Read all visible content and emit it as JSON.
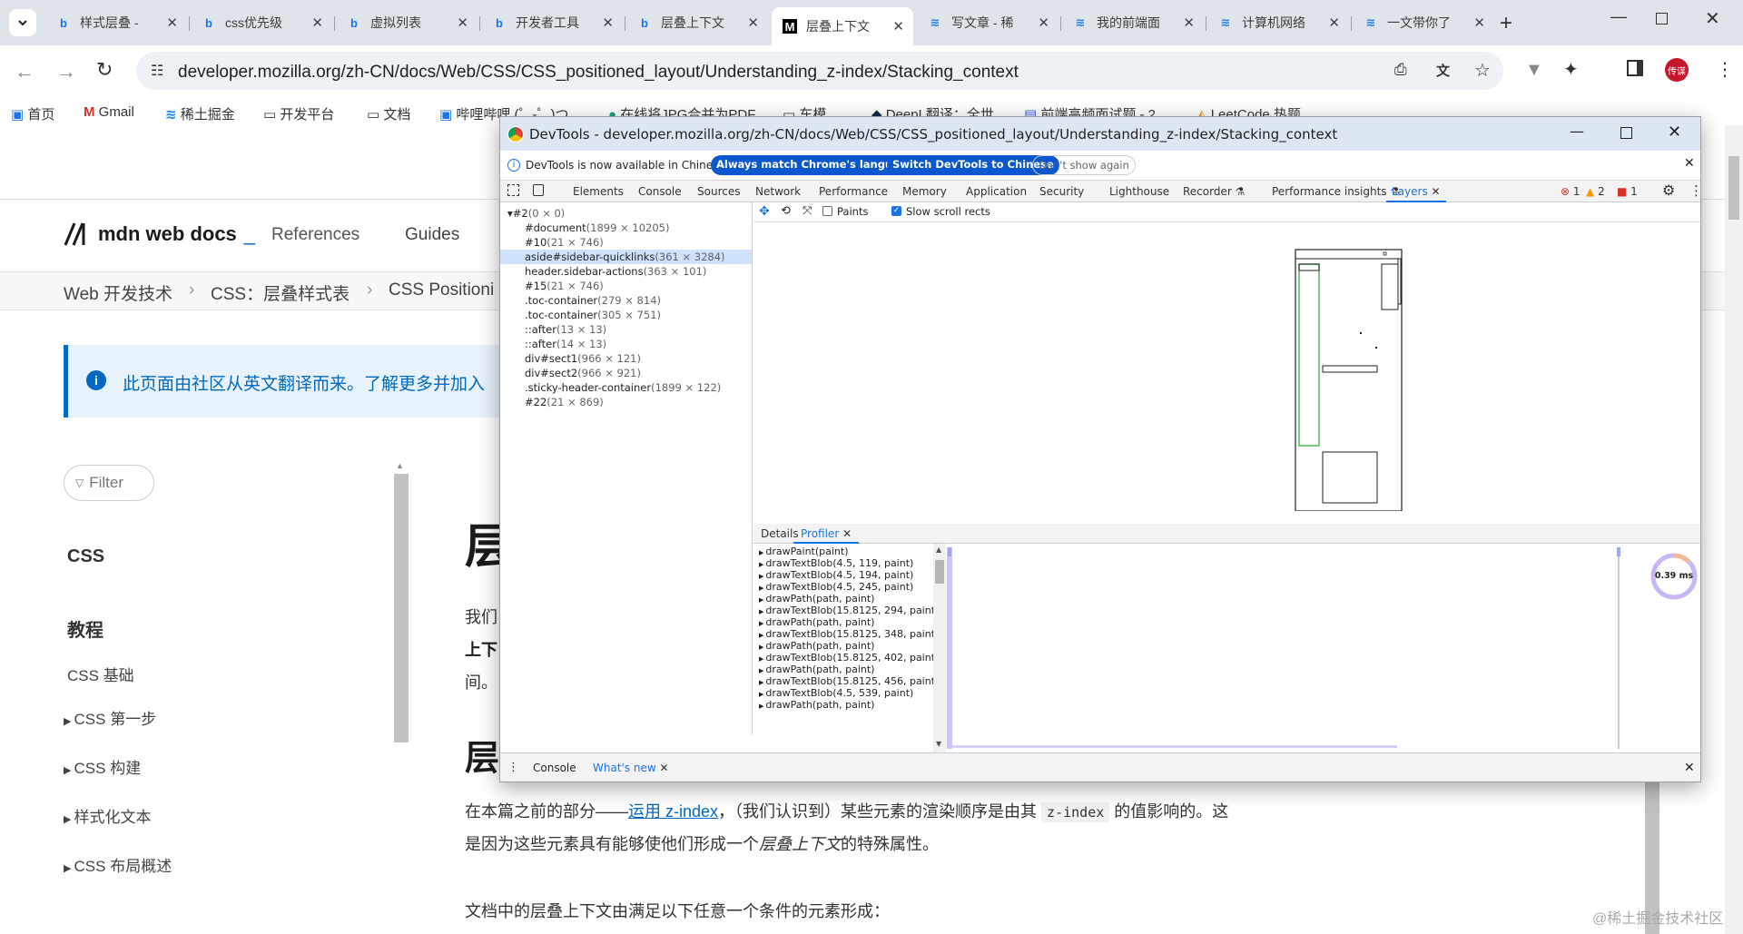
{
  "browser": {
    "tabs": [
      {
        "icon": "bing-icon",
        "title": "样式层叠 -"
      },
      {
        "icon": "bing-icon",
        "title": "css优先级"
      },
      {
        "icon": "bing-icon",
        "title": "虚拟列表"
      },
      {
        "icon": "bing-icon",
        "title": "开发者工具"
      },
      {
        "icon": "bing-icon",
        "title": "层叠上下文"
      },
      {
        "icon": "mdn-icon",
        "title": "层叠上下文"
      },
      {
        "icon": "juejin-icon",
        "title": "写文章 - 稀"
      },
      {
        "icon": "juejin-icon",
        "title": "我的前端面"
      },
      {
        "icon": "juejin-icon",
        "title": "计算机网络"
      },
      {
        "icon": "juejin-icon",
        "title": "一文带你了"
      }
    ],
    "url": "developer.mozilla.org/zh-CN/docs/Web/CSS/CSS_positioned_layout/Understanding_z-index/Stacking_context",
    "profile_label": "传谋",
    "bookmarks": [
      "首页",
      "Gmail",
      "稀土掘金",
      "开发平台",
      "文档",
      "哔哩哔哩 (゜-゜)つ",
      "在线将JPG合并为PDF",
      "车模",
      "DeepL翻译：全世",
      "前端高频面试题 - 2",
      "LeetCode 热题"
    ]
  },
  "page": {
    "logo": "mdn web docs",
    "nav": [
      "References",
      "Guides"
    ],
    "breadcrumb": [
      "Web 开发技术",
      "CSS：层叠样式表",
      "CSS Positioni"
    ],
    "notice": "此页面由社区从英文翻译而来。了解更多并加入",
    "filter_placeholder": "Filter",
    "sidebar": {
      "heading": "CSS",
      "section": "教程",
      "items": [
        "CSS 基础",
        "CSS 第一步",
        "CSS 构建",
        "样式化文本",
        "CSS 布局概述"
      ]
    },
    "article": {
      "title_partial": "层",
      "p1_partial": "我们",
      "p1_line2": "上下",
      "p1_line3": "间。",
      "h2_partial": "层",
      "p2_a": "在本篇之前的部分——",
      "p2_link": "运用 z-index",
      "p2_b": "，（我们认识到）某些元素的渲染顺序是由其",
      "p2_code": "z-index",
      "p2_c": "的值影响的。这",
      "p2_line2_a": "是因为这些元素具有能够使他们形成一个",
      "p2_line2_em": "层叠上下文",
      "p2_line2_b": "的特殊属性。",
      "p3": "文档中的层叠上下文由满足以下任意一个条件的元素形成：",
      "watermark": "@稀土掘金技术社区"
    }
  },
  "devtools": {
    "title": "DevTools - developer.mozilla.org/zh-CN/docs/Web/CSS/CSS_positioned_layout/Understanding_z-index/Stacking_context",
    "infobar": {
      "message": "DevTools is now available in Chinese!",
      "btn_match": "Always match Chrome's language",
      "btn_switch": "Switch DevTools to Chinese",
      "btn_dont": "Don't show again"
    },
    "tabs": [
      "Elements",
      "Console",
      "Sources",
      "Network",
      "Performance",
      "Memory",
      "Application",
      "Security",
      "Lighthouse",
      "Recorder",
      "Performance insights",
      "Layers"
    ],
    "status": {
      "errors": "1",
      "warnings": "2",
      "issues": "1"
    },
    "layer_tree": [
      {
        "name": "▾#2",
        "size": "(0 × 0)",
        "indent": 0
      },
      {
        "name": "#document",
        "size": "(1899 × 10205)",
        "indent": 1
      },
      {
        "name": "#10",
        "size": "(21 × 746)",
        "indent": 1
      },
      {
        "name": "aside#sidebar-quicklinks",
        "size": "(361 × 3284)",
        "indent": 1,
        "selected": true
      },
      {
        "name": "header.sidebar-actions",
        "size": "(363 × 101)",
        "indent": 1
      },
      {
        "name": "#15",
        "size": "(21 × 746)",
        "indent": 1
      },
      {
        "name": ".toc-container",
        "size": "(279 × 814)",
        "indent": 1
      },
      {
        "name": ".toc-container",
        "size": "(305 × 751)",
        "indent": 1
      },
      {
        "name": "::after",
        "size": "(13 × 13)",
        "indent": 1
      },
      {
        "name": "::after",
        "size": "(14 × 13)",
        "indent": 1
      },
      {
        "name": "div#sect1",
        "size": "(966 × 121)",
        "indent": 1
      },
      {
        "name": "div#sect2",
        "size": "(966 × 921)",
        "indent": 1
      },
      {
        "name": ".sticky-header-container",
        "size": "(1899 × 122)",
        "indent": 1
      },
      {
        "name": "#22",
        "size": "(21 × 869)",
        "indent": 1
      }
    ],
    "layers_toolbar": {
      "paints": "Paints",
      "slow_scroll": "Slow scroll rects"
    },
    "bottom_tabs": [
      "Details",
      "Profiler"
    ],
    "profiler_rows": [
      "drawPaint(paint)",
      "drawTextBlob(4.5, 119, paint)",
      "drawTextBlob(4.5, 194, paint)",
      "drawTextBlob(4.5, 245, paint)",
      "drawPath(path, paint)",
      "drawTextBlob(15.8125, 294, paint)",
      "drawPath(path, paint)",
      "drawTextBlob(15.8125, 348, paint)",
      "drawPath(path, paint)",
      "drawTextBlob(15.8125, 402, paint)",
      "drawPath(path, paint)",
      "drawTextBlob(15.8125, 456, paint)",
      "drawTextBlob(4.5, 539, paint)",
      "drawPath(path, paint)"
    ],
    "profiler_time": "0.39 ms",
    "drawer_tabs": [
      "Console",
      "What's new"
    ]
  }
}
